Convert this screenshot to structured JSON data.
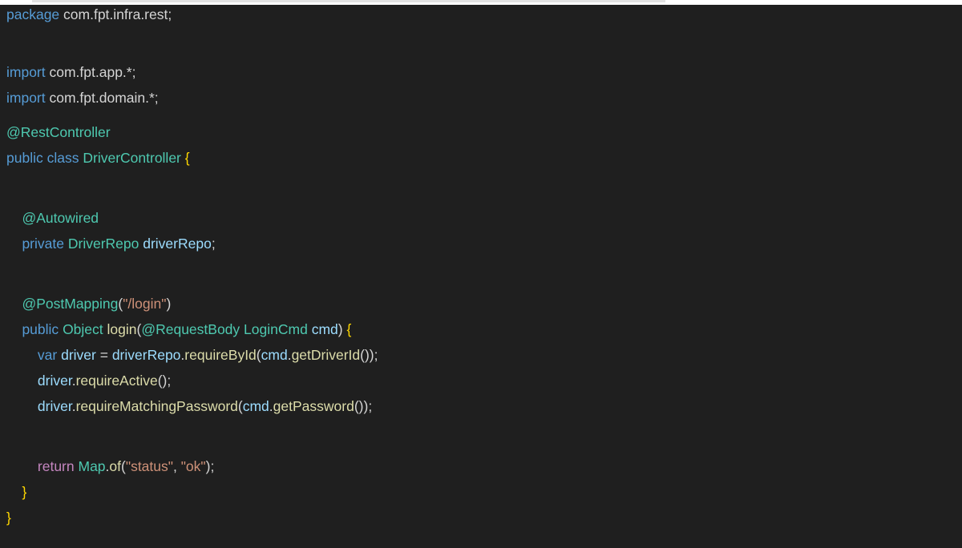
{
  "colors": {
    "background": "#1f1f1f",
    "keyword": "#569cd6",
    "control": "#c586c0",
    "type": "#4ec9b0",
    "variable": "#9cdcfe",
    "function": "#dcdcaa",
    "string": "#ce9178",
    "brace": "#ffd700",
    "plain": "#d4d4d4"
  },
  "code": {
    "l1": {
      "a": "package",
      "b": " com.fpt.infra.rest;"
    },
    "l3": {
      "a": "import",
      "b": " com.fpt.app.*;"
    },
    "l4": {
      "a": "import",
      "b": " com.fpt.domain.*;"
    },
    "l6": {
      "a": "@RestController"
    },
    "l7": {
      "a": "public",
      "b": " ",
      "c": "class",
      "d": " ",
      "e": "DriverController",
      "f": " ",
      "g": "{"
    },
    "l9": {
      "a": "    ",
      "b": "@Autowired"
    },
    "l10": {
      "a": "    ",
      "b": "private",
      "c": " ",
      "d": "DriverRepo",
      "e": " ",
      "f": "driverRepo",
      "g": ";"
    },
    "l12": {
      "a": "    ",
      "b": "@PostMapping",
      "c": "(",
      "d": "\"/login\"",
      "e": ")"
    },
    "l13": {
      "a": "    ",
      "b": "public",
      "c": " ",
      "d": "Object",
      "e": " ",
      "f": "login",
      "g": "(",
      "h": "@RequestBody",
      "i": " ",
      "j": "LoginCmd",
      "k": " ",
      "l": "cmd",
      "m": ") ",
      "n": "{"
    },
    "l14": {
      "a": "        ",
      "b": "var",
      "c": " ",
      "d": "driver",
      "e": " = ",
      "f": "driverRepo",
      "g": ".",
      "h": "requireById",
      "i": "(",
      "j": "cmd",
      "k": ".",
      "l": "getDriverId",
      "m": "());"
    },
    "l15": {
      "a": "        ",
      "b": "driver",
      "c": ".",
      "d": "requireActive",
      "e": "();"
    },
    "l16": {
      "a": "        ",
      "b": "driver",
      "c": ".",
      "d": "requireMatchingPassword",
      "e": "(",
      "f": "cmd",
      "g": ".",
      "h": "getPassword",
      "i": "());"
    },
    "l18": {
      "a": "        ",
      "b": "return",
      "c": " ",
      "d": "Map",
      "e": ".",
      "f": "of",
      "g": "(",
      "h": "\"status\"",
      "i": ", ",
      "j": "\"ok\"",
      "k": ");"
    },
    "l19": {
      "a": "    ",
      "b": "}"
    },
    "l20": {
      "a": "}"
    }
  }
}
